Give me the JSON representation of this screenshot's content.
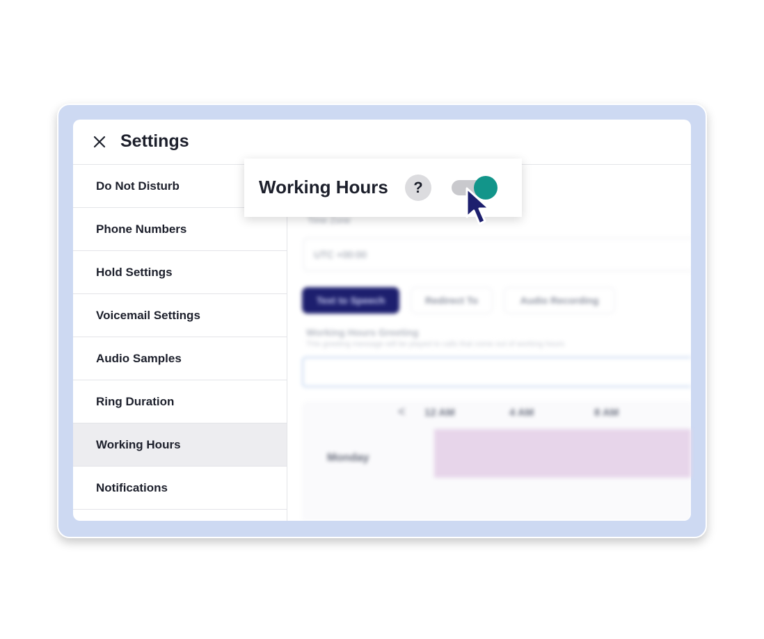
{
  "header": {
    "title": "Settings"
  },
  "sidebar": {
    "items": [
      {
        "label": "Do Not Disturb",
        "active": false
      },
      {
        "label": "Phone Numbers",
        "active": false
      },
      {
        "label": "Hold Settings",
        "active": false
      },
      {
        "label": "Voicemail Settings",
        "active": false
      },
      {
        "label": "Audio Samples",
        "active": false
      },
      {
        "label": "Ring Duration",
        "active": false
      },
      {
        "label": "Working Hours",
        "active": true
      },
      {
        "label": "Notifications",
        "active": false
      }
    ]
  },
  "popover": {
    "title": "Working Hours",
    "help_icon": "question-icon",
    "help_glyph": "?",
    "toggle_on": true
  },
  "content": {
    "time_zone_label": "Time Zone",
    "time_zone_value": "UTC +00:00",
    "tabs": [
      "Text to Speech",
      "Redirect To",
      "Audio Recording"
    ],
    "greeting_label": "Working Hours Greeting",
    "greeting_sub": "This greeting message will be played to calls that come out of working hours",
    "schedule": {
      "nav_arrow": "<",
      "times": [
        "12 AM",
        "4 AM",
        "8 AM"
      ],
      "day": "Monday"
    }
  },
  "colors": {
    "frame": "#cdd9f2",
    "accent_tab": "#1d1f6e",
    "toggle_on": "#12958a",
    "cursor": "#1d1f6e",
    "schedule_block": "#e7d5ea"
  }
}
